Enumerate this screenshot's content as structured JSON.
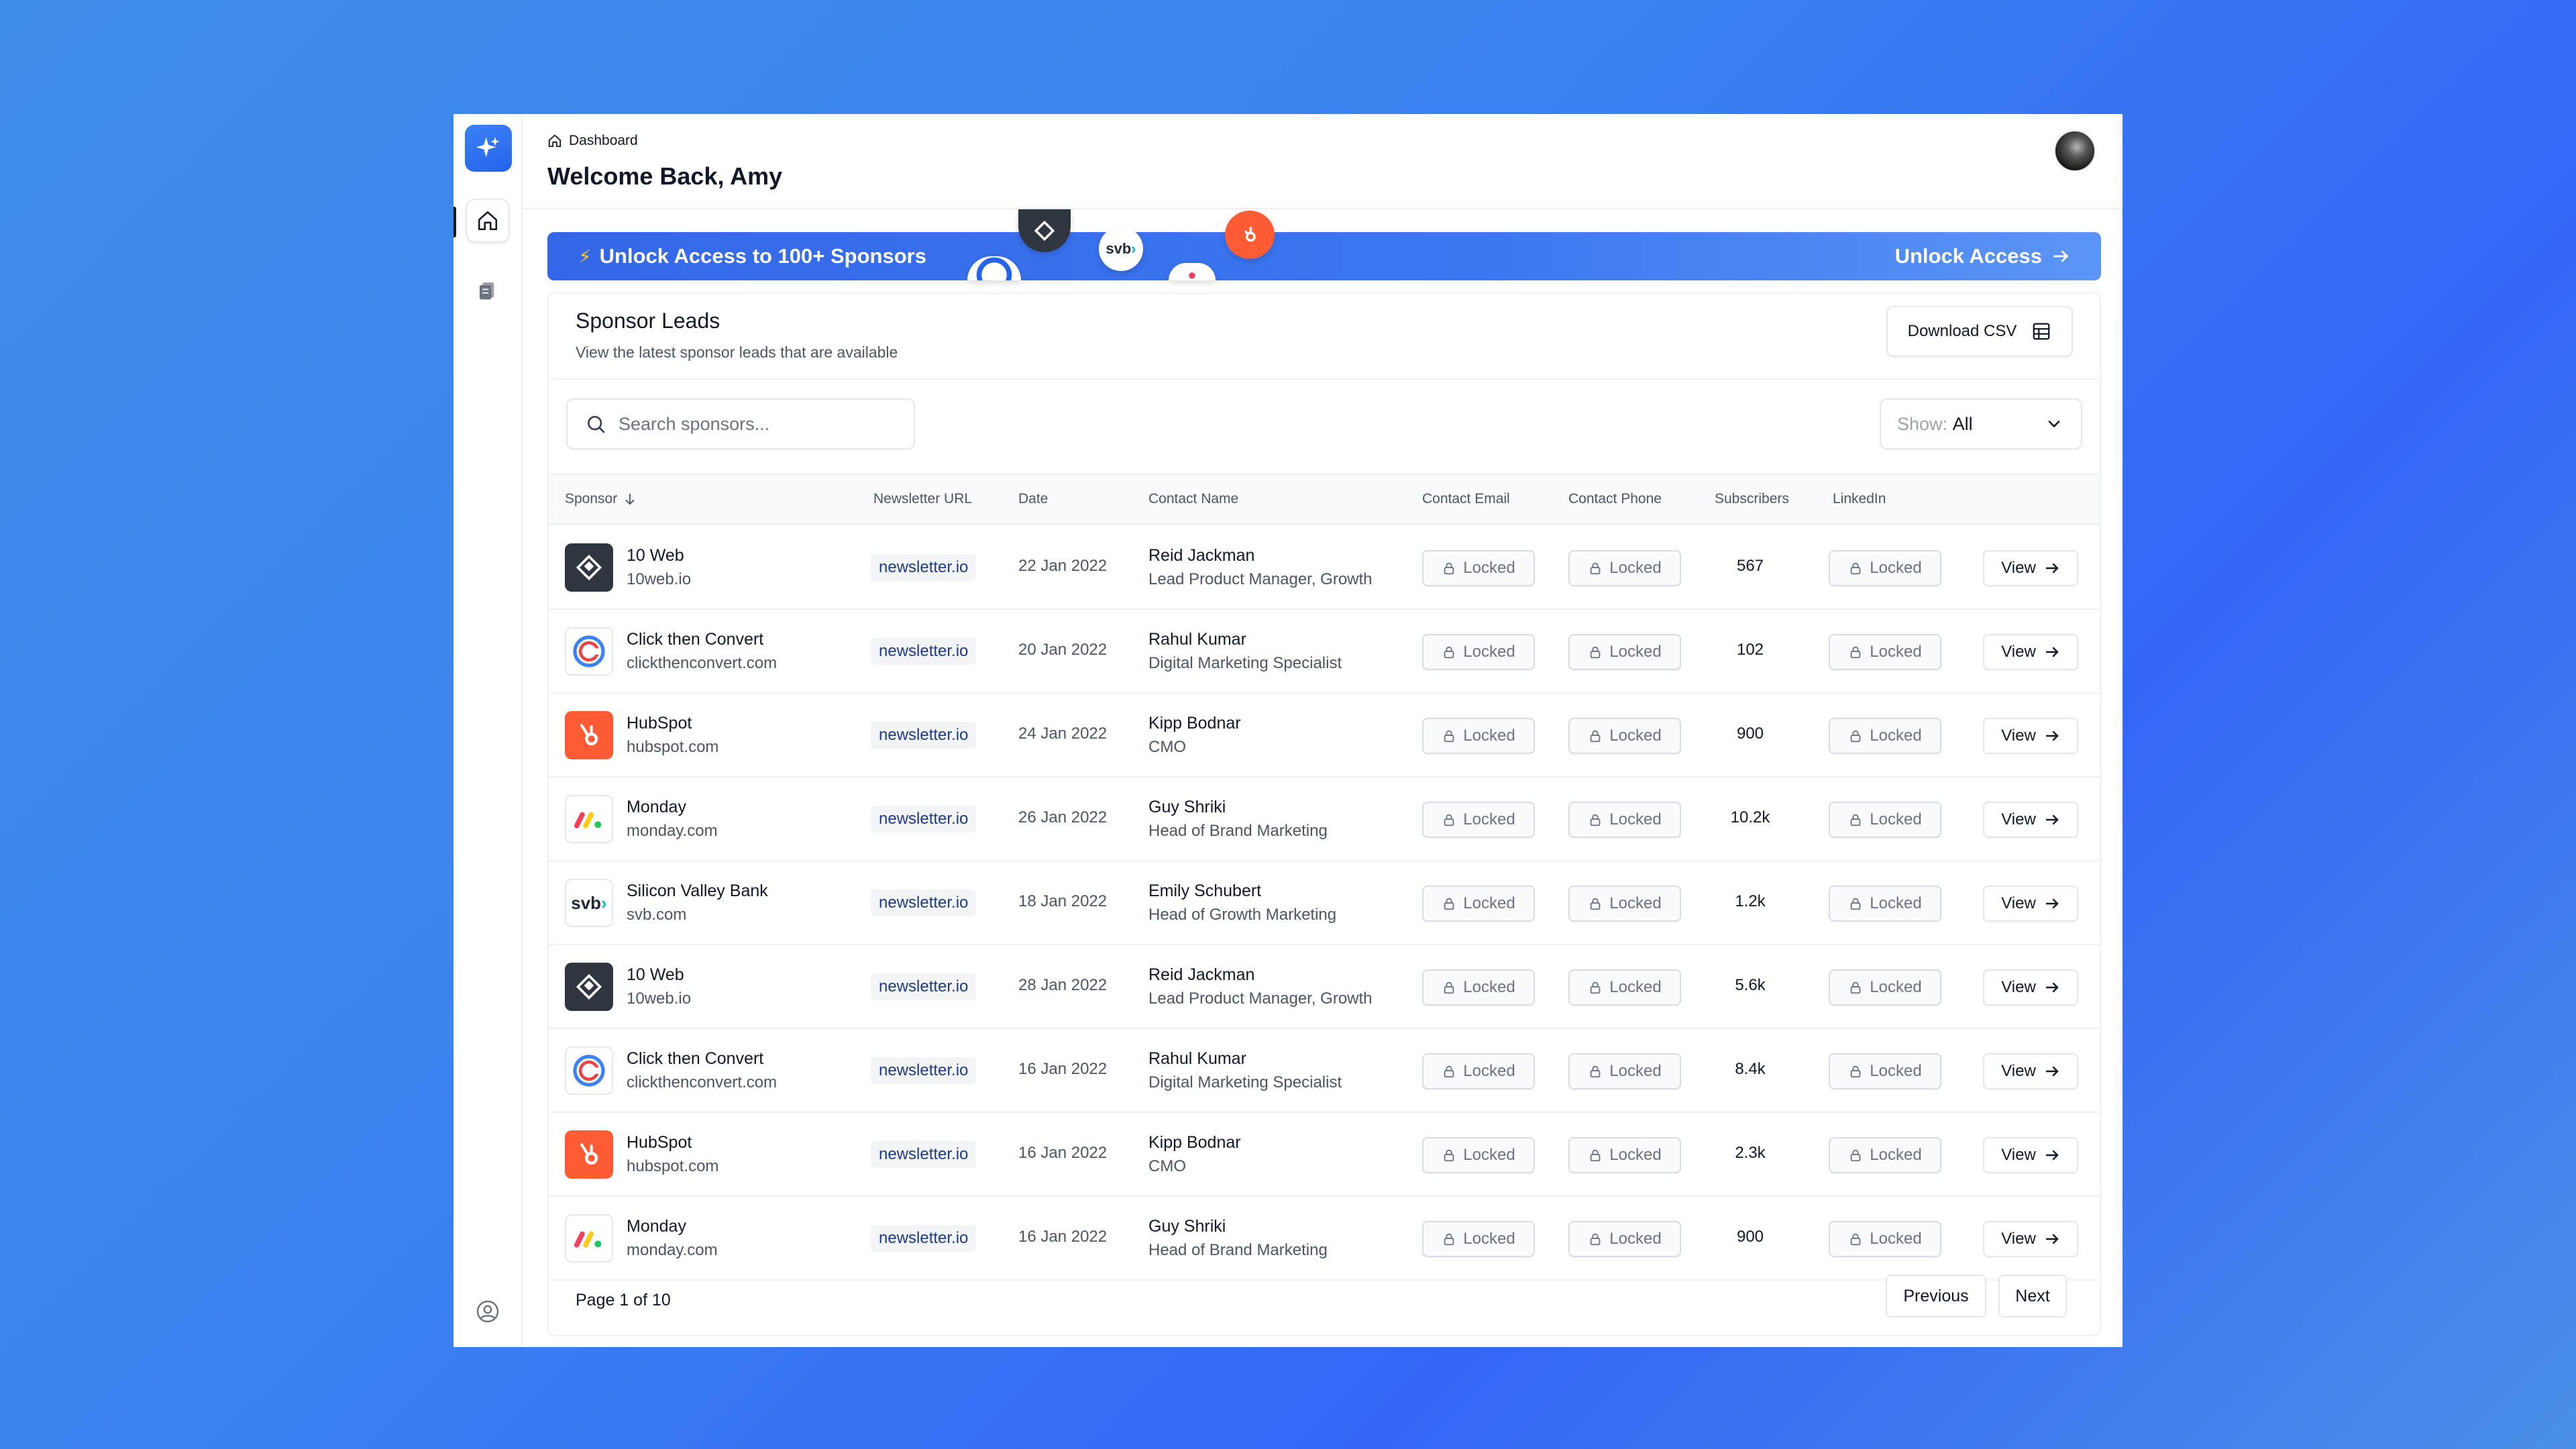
{
  "header": {
    "breadcrumb": "Dashboard",
    "welcome": "Welcome Back, Amy"
  },
  "banner": {
    "text": "Unlock Access to 100+ Sponsors",
    "cta": "Unlock Access"
  },
  "leads": {
    "title": "Sponsor Leads",
    "subtitle": "View the latest sponsor leads that are available",
    "download_label": "Download CSV",
    "search_placeholder": "Search sponsors...",
    "show_label": "Show:",
    "show_value": "All",
    "columns": [
      "Sponsor",
      "Newsletter URL",
      "Date",
      "Contact Name",
      "Contact Email",
      "Contact Phone",
      "Subscribers",
      "LinkedIn"
    ],
    "locked_label": "Locked",
    "view_label": "View",
    "rows": [
      {
        "sponsor": "10 Web",
        "domain": "10web.io",
        "logo": "10web-logo",
        "url": "newsletter.io",
        "date": "22 Jan 2022",
        "contact": "Reid Jackman",
        "role": "Lead Product Manager, Growth",
        "subscribers": "567"
      },
      {
        "sponsor": "Click then Convert",
        "domain": "clickthenconvert.com",
        "logo": "clickthenconvert-logo",
        "url": "newsletter.io",
        "date": "20 Jan 2022",
        "contact": "Rahul Kumar",
        "role": "Digital Marketing Specialist",
        "subscribers": "102"
      },
      {
        "sponsor": "HubSpot",
        "domain": "hubspot.com",
        "logo": "hubspot-logo",
        "url": "newsletter.io",
        "date": "24 Jan 2022",
        "contact": "Kipp Bodnar",
        "role": "CMO",
        "subscribers": "900"
      },
      {
        "sponsor": "Monday",
        "domain": "monday.com",
        "logo": "monday-logo",
        "url": "newsletter.io",
        "date": "26 Jan 2022",
        "contact": "Guy Shriki",
        "role": "Head of Brand Marketing",
        "subscribers": "10.2k"
      },
      {
        "sponsor": "Silicon Valley Bank",
        "domain": "svb.com",
        "logo": "svb-logo",
        "url": "newsletter.io",
        "date": "18 Jan 2022",
        "contact": "Emily Schubert",
        "role": "Head of Growth Marketing",
        "subscribers": "1.2k"
      },
      {
        "sponsor": "10 Web",
        "domain": "10web.io",
        "logo": "10web-logo",
        "url": "newsletter.io",
        "date": "28 Jan 2022",
        "contact": "Reid Jackman",
        "role": "Lead Product Manager, Growth",
        "subscribers": "5.6k"
      },
      {
        "sponsor": "Click then Convert",
        "domain": "clickthenconvert.com",
        "logo": "clickthenconvert-logo",
        "url": "newsletter.io",
        "date": "16 Jan 2022",
        "contact": "Rahul Kumar",
        "role": "Digital Marketing Specialist",
        "subscribers": "8.4k"
      },
      {
        "sponsor": "HubSpot",
        "domain": "hubspot.com",
        "logo": "hubspot-logo",
        "url": "newsletter.io",
        "date": "16 Jan 2022",
        "contact": "Kipp Bodnar",
        "role": "CMO",
        "subscribers": "2.3k"
      },
      {
        "sponsor": "Monday",
        "domain": "monday.com",
        "logo": "monday-logo",
        "url": "newsletter.io",
        "date": "16 Jan 2022",
        "contact": "Guy Shriki",
        "role": "Head of Brand Marketing",
        "subscribers": "900"
      }
    ]
  },
  "pagination": {
    "info": "Page 1 of 10",
    "previous": "Previous",
    "next": "Next"
  },
  "colors": {
    "accent": "#3b82f6",
    "hubspot": "#ff5c35",
    "tenweb": "#2f3640",
    "url_text": "#1e3a8a"
  }
}
